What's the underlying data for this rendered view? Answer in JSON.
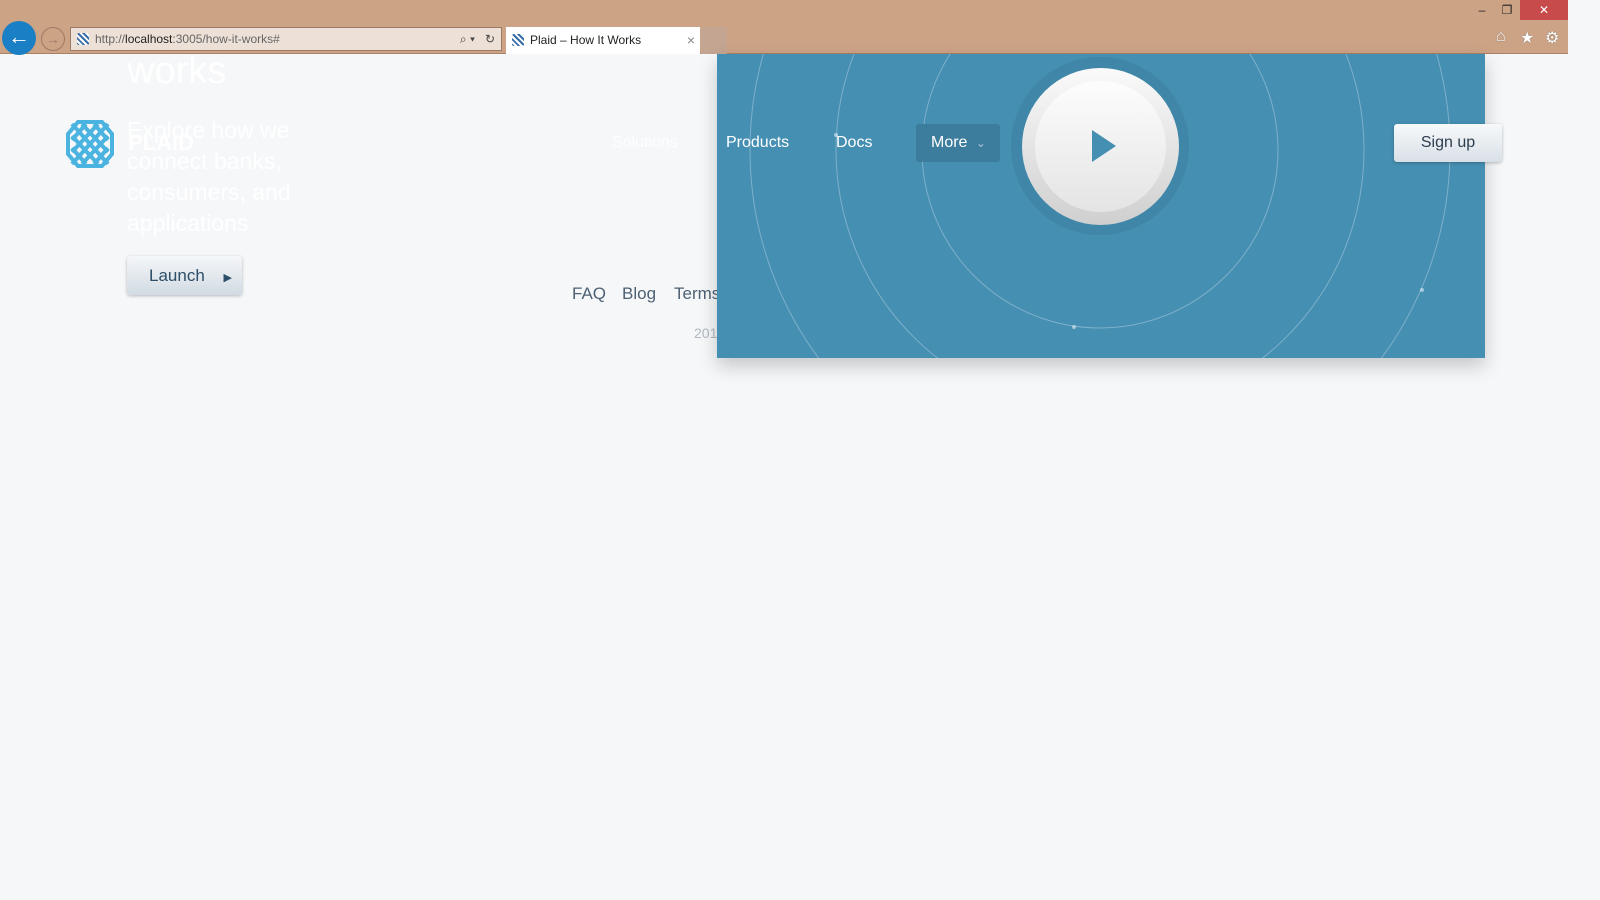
{
  "browser": {
    "url_prefix": "http://",
    "url_host": "localhost",
    "url_rest": ":3005/how-it-works#",
    "tab_title": "Plaid – How It Works",
    "minimize": "–",
    "restore": "❐",
    "close": "✕",
    "home": "⌂",
    "favorites": "★",
    "settings": "⚙",
    "back": "←",
    "forward": "→",
    "search": "⌕ ▾",
    "refresh": "↻",
    "tab_close": "×"
  },
  "hero": {
    "title": "works",
    "subtitle": "Explore how we connect banks, consumers, and applications",
    "launch_label": "Launch",
    "launch_icon": "▶"
  },
  "header": {
    "logo_text": "PLAID",
    "nav": [
      "Solutions",
      "Products",
      "Docs"
    ],
    "more_label": "More",
    "more_icon": "⌄",
    "signup_label": "Sign up"
  },
  "footer": {
    "links": [
      "FAQ",
      "Blog",
      "Terms"
    ],
    "copyright": "201"
  },
  "colors": {
    "panel": "#458fb2",
    "chrome": "#cda386",
    "logo": "#4ab3e0"
  }
}
